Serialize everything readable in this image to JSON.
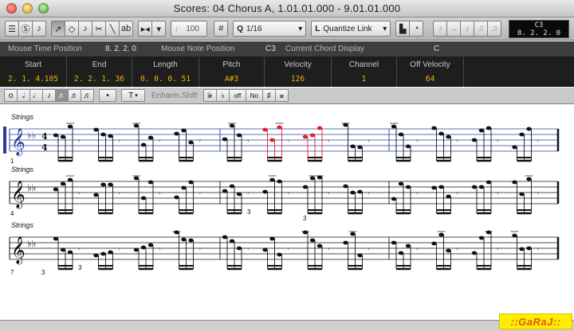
{
  "window": {
    "title": "Scores: 04 Chorus A, 1.01.01.000 - 9.01.01.000"
  },
  "toolbar": {
    "quantize_value": "1/16",
    "quantize_mode": "Quantize Link",
    "velocity_value": "100",
    "display": {
      "pitch": "C3",
      "position": "8. 2. 2.  0"
    }
  },
  "infoline": {
    "mouse_time_label": "Mouse Time Position",
    "mouse_time_value": "8. 2. 2.  0",
    "mouse_note_label": "Mouse Note Position",
    "mouse_note_value": "C3",
    "chord_label": "Current Chord Display",
    "chord_value": "C"
  },
  "event_info": {
    "columns": [
      {
        "header": "Start",
        "value": "2. 1. 4.105"
      },
      {
        "header": "End",
        "value": "2. 2. 1. 36"
      },
      {
        "header": "Length",
        "value": "0. 0. 0. 51"
      },
      {
        "header": "Pitch",
        "value": "A#3"
      },
      {
        "header": "Velocity",
        "value": "126"
      },
      {
        "header": "Channel",
        "value": "1"
      },
      {
        "header": "Off Velocity",
        "value": "64"
      }
    ]
  },
  "symbols": {
    "enharm_label": "Enharm.Shift",
    "tuplet_label": "T",
    "enh_off": "off",
    "enh_no": "No"
  },
  "score": {
    "staves": [
      {
        "label": "Strings",
        "measure": "1"
      },
      {
        "label": "Strings",
        "measure": "4"
      },
      {
        "label": "Strings",
        "measure": "7"
      }
    ],
    "tuplet_marks": [
      "3",
      "3",
      "3",
      "3"
    ]
  },
  "watermark": "::GaRaJ::",
  "colors": {
    "selection": "#2b3d9a",
    "selected_note": "#e0202a",
    "value_text": "#f0b400"
  }
}
